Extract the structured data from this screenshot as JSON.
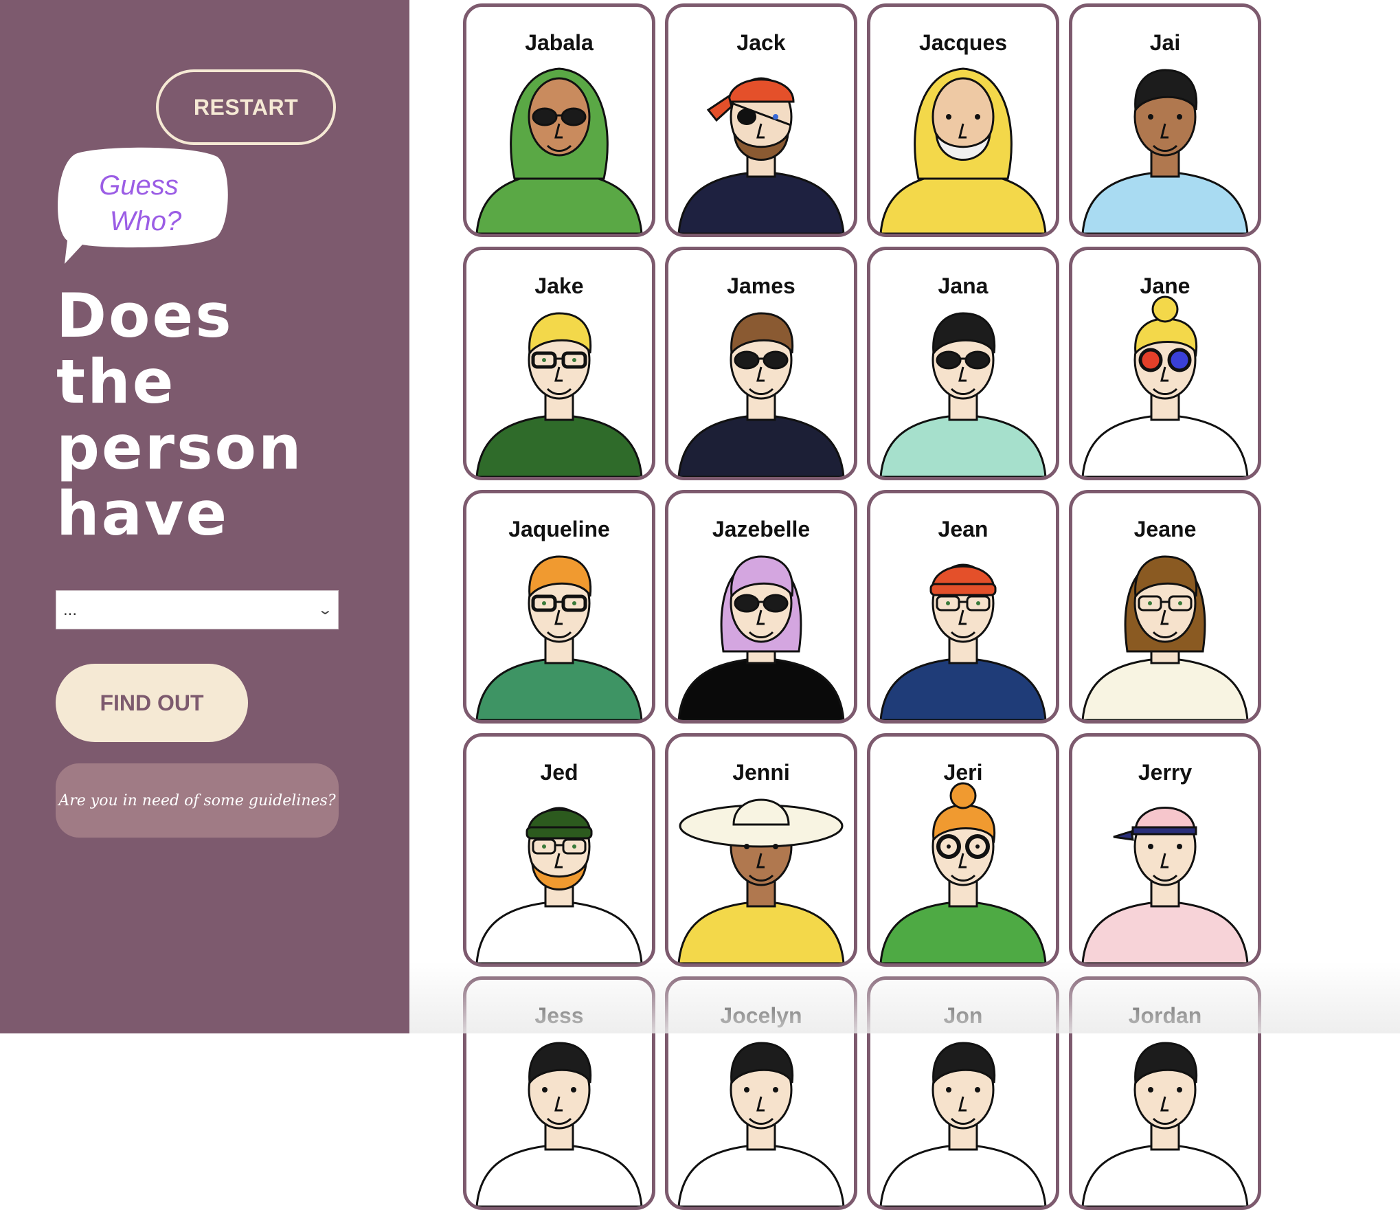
{
  "sidebar": {
    "restart_label": "RESTART",
    "bubble_line1": "Guess",
    "bubble_line2": "Who?",
    "question_lines": [
      "Does",
      "the",
      "person",
      "have"
    ],
    "select_value": "...",
    "findout_label": "FIND OUT",
    "guidelines_label": "Are you in need of some guidelines?"
  },
  "colors": {
    "sidebar_bg": "#7d5a6e",
    "cream": "#f5e9d4",
    "bubble_text": "#9b5de5",
    "card_border": "#7d5a6e"
  },
  "cards": [
    {
      "name": "Jabala",
      "hair": "#5aa845",
      "skin": "#c98b5e",
      "shirt": "#5aa845",
      "glasses": "sunglasses",
      "hat": "hijab"
    },
    {
      "name": "Jack",
      "hair": "#e4502a",
      "skin": "#f3dcc4",
      "shirt": "#1e2140",
      "glasses": "eyepatch",
      "hat": "bandana"
    },
    {
      "name": "Jacques",
      "hair": "#f3d84a",
      "skin": "#eec9a4",
      "shirt": "#f3d84a",
      "glasses": "none",
      "hat": "hood"
    },
    {
      "name": "Jai",
      "hair": "#1c1c1c",
      "skin": "#b0784f",
      "shirt": "#a9dbf2",
      "glasses": "none",
      "hat": "none"
    },
    {
      "name": "Jake",
      "hair": "#f3d84a",
      "skin": "#f6e2cc",
      "shirt": "#2f6b2a",
      "glasses": "black",
      "hat": "none"
    },
    {
      "name": "James",
      "hair": "#8a5a32",
      "skin": "#f6e2cc",
      "shirt": "#1c1f36",
      "glasses": "sunglasses",
      "hat": "none"
    },
    {
      "name": "Jana",
      "hair": "#1c1c1c",
      "skin": "#f6e2cc",
      "shirt": "#a6e0cc",
      "glasses": "sunglasses",
      "hat": "none"
    },
    {
      "name": "Jane",
      "hair": "#f3d84a",
      "skin": "#f6e2cc",
      "shirt": "#ffffff",
      "glasses": "color",
      "hat": "bun"
    },
    {
      "name": "Jaqueline",
      "hair": "#f09a30",
      "skin": "#f6e2cc",
      "shirt": "#3e9464",
      "glasses": "black",
      "hat": "none"
    },
    {
      "name": "Jazebelle",
      "hair": "#d4a6e0",
      "skin": "#f6e2cc",
      "shirt": "#0a0a0a",
      "glasses": "sunglasses",
      "hat": "none"
    },
    {
      "name": "Jean",
      "hair": "#e4502a",
      "skin": "#f6e2cc",
      "shirt": "#1f3c78",
      "glasses": "thin",
      "hat": "beanie"
    },
    {
      "name": "Jeane",
      "hair": "#8a5a22",
      "skin": "#f6e2cc",
      "shirt": "#f8f4e2",
      "glasses": "thin",
      "hat": "none"
    },
    {
      "name": "Jed",
      "hair": "#2c5a1e",
      "skin": "#f6e2cc",
      "shirt": "#ffffff",
      "glasses": "thin",
      "hat": "beanie"
    },
    {
      "name": "Jenni",
      "hair": "#f8f4e2",
      "skin": "#b0784f",
      "shirt": "#f3d84a",
      "glasses": "none",
      "hat": "sunhat"
    },
    {
      "name": "Jeri",
      "hair": "#f09a30",
      "skin": "#f6e2cc",
      "shirt": "#4eaa44",
      "glasses": "round",
      "hat": "bun"
    },
    {
      "name": "Jerry",
      "hair": "#f6c6cc",
      "skin": "#f6e2cc",
      "shirt": "#f7d3d8",
      "glasses": "none",
      "hat": "cap"
    },
    {
      "name": "Jess",
      "hair": "#1c1c1c",
      "skin": "#f6e2cc",
      "shirt": "#ffffff",
      "glasses": "none",
      "hat": "none"
    },
    {
      "name": "Jocelyn",
      "hair": "#1c1c1c",
      "skin": "#f6e2cc",
      "shirt": "#ffffff",
      "glasses": "none",
      "hat": "none"
    },
    {
      "name": "Jon",
      "hair": "#1c1c1c",
      "skin": "#f6e2cc",
      "shirt": "#ffffff",
      "glasses": "none",
      "hat": "none"
    },
    {
      "name": "Jordan",
      "hair": "#1c1c1c",
      "skin": "#f6e2cc",
      "shirt": "#ffffff",
      "glasses": "none",
      "hat": "none"
    }
  ]
}
